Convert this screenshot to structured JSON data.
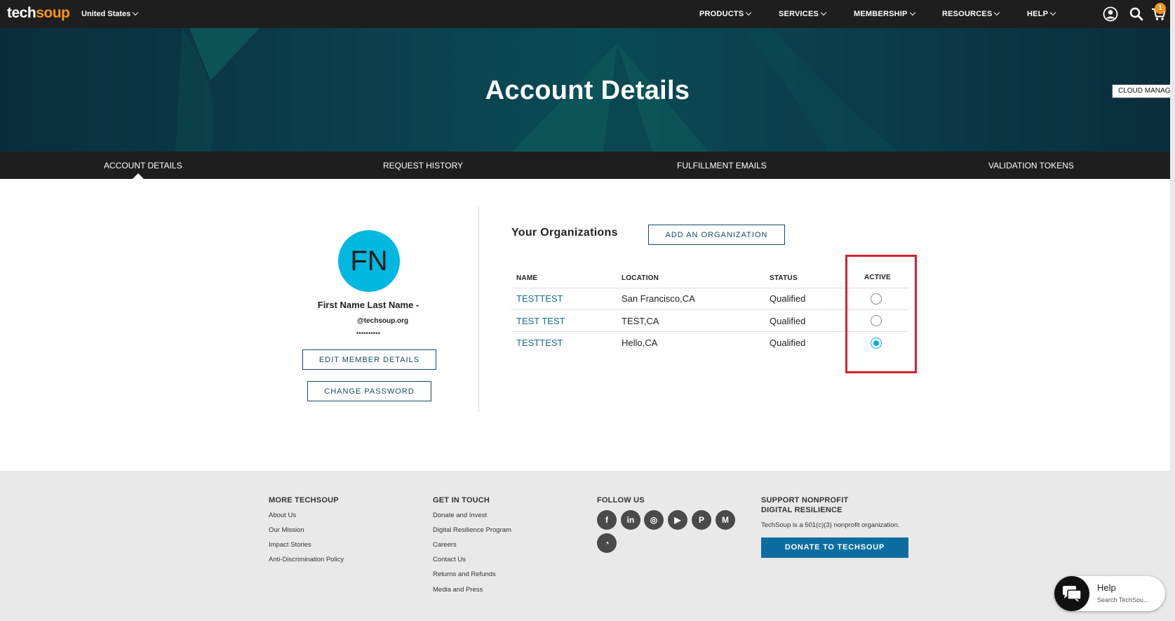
{
  "header": {
    "logo_tech": "tech",
    "logo_soup": "soup",
    "country": "United States",
    "nav": [
      "PRODUCTS",
      "SERVICES",
      "MEMBERSHIP",
      "RESOURCES",
      "HELP"
    ],
    "cart_count": "1",
    "icons": [
      "user-icon",
      "search-icon",
      "cart-icon"
    ]
  },
  "hero": {
    "title": "Account Details",
    "cloud_manager": "CLOUD MANAGER"
  },
  "tabs": [
    "ACCOUNT DETAILS",
    "REQUEST HISTORY",
    "FULFILLMENT EMAILS",
    "VALIDATION TOKENS"
  ],
  "profile": {
    "initials": "FN",
    "name": "First Name Last Name -",
    "email": "@techsoup.org",
    "password_mask": "**********",
    "edit_label": "EDIT MEMBER DETAILS",
    "password_label": "CHANGE PASSWORD"
  },
  "organizations": {
    "title": "Your Organizations",
    "add_label": "ADD AN ORGANIZATION",
    "headers": [
      "NAME",
      "LOCATION",
      "STATUS",
      "ACTIVE"
    ],
    "rows": [
      {
        "name": "TESTTEST",
        "location": "San Francisco,CA",
        "status": "Qualified",
        "active": false
      },
      {
        "name": "TEST TEST",
        "location": "TEST,CA",
        "status": "Qualified",
        "active": false
      },
      {
        "name": "TESTTEST",
        "location": "Hello,CA",
        "status": "Qualified",
        "active": true
      }
    ],
    "highlight_color": "#d8202f"
  },
  "footer": {
    "more": {
      "heading": "MORE TECHSOUP",
      "links": [
        "About Us",
        "Our Mission",
        "Impact Stories",
        "Anti-Discrimination Policy"
      ]
    },
    "touch": {
      "heading": "GET IN TOUCH",
      "links": [
        "Donate and Invest",
        "Digital Resilience Program",
        "Careers",
        "Contact Us",
        "Returns and Refunds",
        "Media and Press"
      ]
    },
    "follow": {
      "heading": "FOLLOW US",
      "icons": [
        {
          "name": "facebook-icon",
          "glyph": "f"
        },
        {
          "name": "linkedin-icon",
          "glyph": "in"
        },
        {
          "name": "instagram-icon",
          "glyph": "◎"
        },
        {
          "name": "youtube-icon",
          "glyph": "▶"
        },
        {
          "name": "pinterest-icon",
          "glyph": "P"
        },
        {
          "name": "medium-icon",
          "glyph": "M"
        },
        {
          "name": "rss-icon",
          "glyph": "◔"
        }
      ]
    },
    "support": {
      "heading_line1": "SUPPORT NONPROFIT",
      "heading_line2": "DIGITAL RESILIENCE",
      "note": "TechSoup is a 501(c)(3) nonprofit organization.",
      "donate_label": "DONATE TO TECHSOUP"
    }
  },
  "help_widget": {
    "title": "Help",
    "subtitle": "Search TechSou..."
  },
  "colors": {
    "brand_orange": "#f7931d",
    "nav_bg": "#1e1e1e",
    "hero_bg": "#093a4b",
    "accent_blue": "#00b8e0",
    "link_teal": "#136e8e"
  }
}
